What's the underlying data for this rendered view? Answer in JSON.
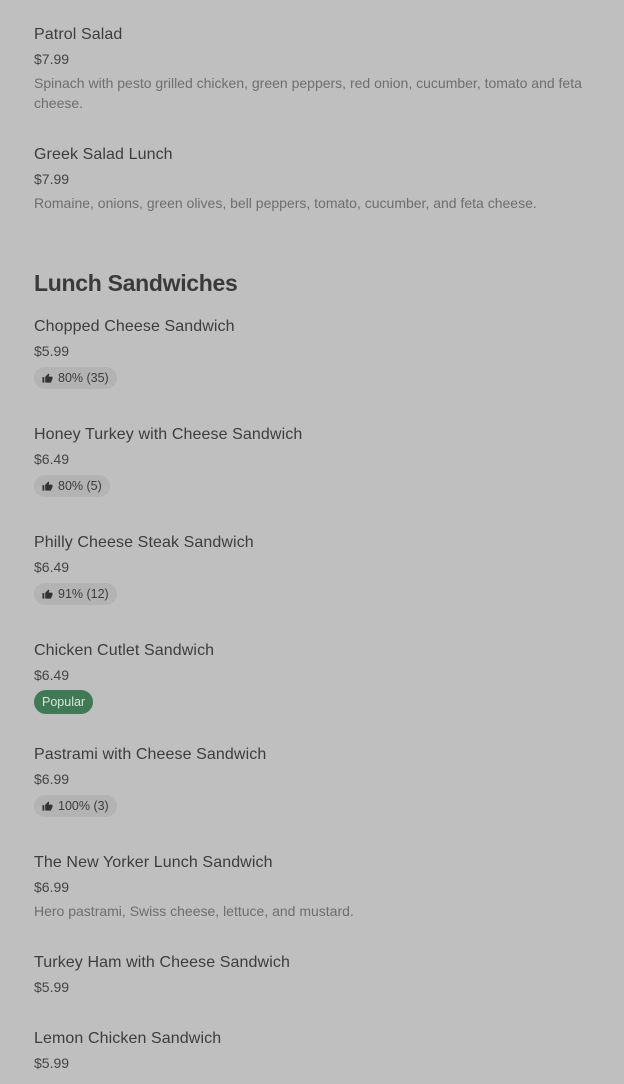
{
  "colors": {
    "background": "#bfbfbf",
    "rating_pill": "#b3b3b3",
    "popular_badge": "#3f7a55"
  },
  "salads": [
    {
      "name": "Patrol Salad",
      "price": "$7.99",
      "description": "Spinach with pesto grilled chicken, green peppers, red onion, cucumber, tomato and feta cheese."
    },
    {
      "name": "Greek Salad Lunch",
      "price": "$7.99",
      "description": "Romaine, onions, green olives, bell peppers, tomato, cucumber, and feta cheese."
    }
  ],
  "section": {
    "title": "Lunch Sandwiches"
  },
  "sandwiches": [
    {
      "name": "Chopped Cheese Sandwich",
      "price": "$5.99",
      "rating": "80% (35)",
      "rating_icon": "thumbs-up-icon"
    },
    {
      "name": "Honey Turkey with Cheese Sandwich",
      "price": "$6.49",
      "rating": "80% (5)",
      "rating_icon": "thumbs-up-icon"
    },
    {
      "name": "Philly Cheese Steak Sandwich",
      "price": "$6.49",
      "rating": "91% (12)",
      "rating_icon": "thumbs-up-icon"
    },
    {
      "name": "Chicken Cutlet Sandwich",
      "price": "$6.49",
      "badge": "Popular"
    },
    {
      "name": "Pastrami with Cheese Sandwich",
      "price": "$6.99",
      "rating": "100% (3)",
      "rating_icon": "thumbs-up-icon"
    },
    {
      "name": "The New Yorker Lunch Sandwich",
      "price": "$6.99",
      "description": "Hero pastrami, Swiss cheese, lettuce, and mustard."
    },
    {
      "name": "Turkey Ham with Cheese Sandwich",
      "price": "$5.99"
    },
    {
      "name": "Lemon Chicken Sandwich",
      "price": "$5.99"
    }
  ]
}
